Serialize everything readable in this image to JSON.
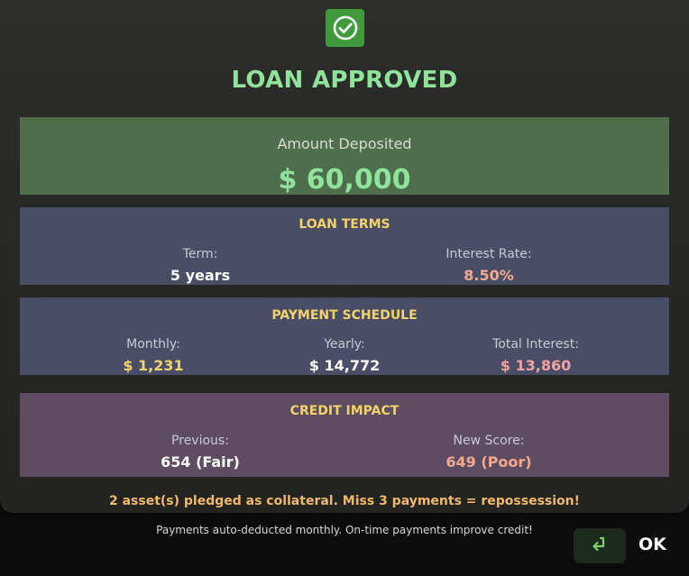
{
  "dialog": {
    "title": "LOAN APPROVED",
    "status_icon": "check-circle-icon",
    "accent_color": "#8fe39a"
  },
  "deposit": {
    "label": "Amount Deposited",
    "amount": "$ 60,000"
  },
  "terms": {
    "title": "LOAN TERMS",
    "term_label": "Term:",
    "term_value": "5 years",
    "rate_label": "Interest Rate:",
    "rate_value": "8.50%"
  },
  "schedule": {
    "title": "PAYMENT SCHEDULE",
    "monthly_label": "Monthly:",
    "monthly_value": "$ 1,231",
    "yearly_label": "Yearly:",
    "yearly_value": "$ 14,772",
    "total_label": "Total Interest:",
    "total_value": "$ 13,860"
  },
  "credit": {
    "title": "CREDIT IMPACT",
    "previous_label": "Previous:",
    "previous_value": "654 (Fair)",
    "new_label": "New Score:",
    "new_value": "649 (Poor)"
  },
  "warning": "2 asset(s) pledged as collateral. Miss 3 payments = repossession!",
  "footer": {
    "note": "Payments auto-deducted monthly. On-time payments improve credit!",
    "ok_icon": "enter-key-icon",
    "ok_label": "OK"
  }
}
